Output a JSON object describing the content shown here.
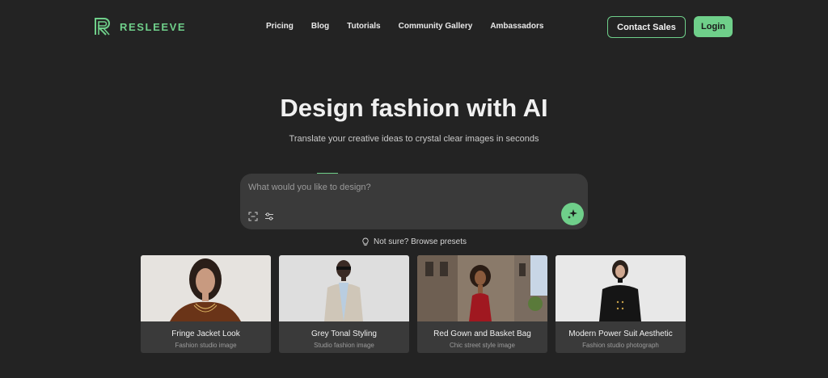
{
  "brand": {
    "name": "RESLEEVE",
    "icon": "r-logo-icon",
    "accent": "#6fcf8a"
  },
  "nav": {
    "links": [
      "Pricing",
      "Blog",
      "Tutorials",
      "Community Gallery",
      "Ambassadors"
    ],
    "contact_label": "Contact Sales",
    "login_label": "Login"
  },
  "hero": {
    "title": "Design fashion with AI",
    "subtitle": "Translate your creative ideas to crystal clear images in seconds"
  },
  "prompt": {
    "placeholder": "What would you like to design?",
    "value": "",
    "tools": [
      "scan-icon",
      "sliders-icon"
    ],
    "submit_icon": "sparkle-icon"
  },
  "hint": {
    "icon": "lightbulb-icon",
    "label": "Not sure? Browse presets"
  },
  "presets": [
    {
      "title": "Fringe Jacket Look",
      "subtitle": "Fashion studio image"
    },
    {
      "title": "Grey Tonal Styling",
      "subtitle": "Studio fashion image"
    },
    {
      "title": "Red Gown and Basket Bag",
      "subtitle": "Chic street style image"
    },
    {
      "title": "Modern Power Suit Aesthetic",
      "subtitle": "Fashion studio photograph"
    }
  ]
}
